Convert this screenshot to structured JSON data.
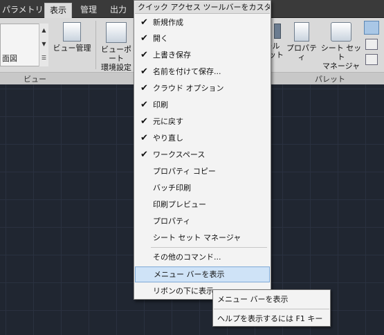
{
  "tabs": [
    {
      "label": "パラメトリック"
    },
    {
      "label": "表示"
    },
    {
      "label": "管理"
    },
    {
      "label": "出力"
    }
  ],
  "ribbon": {
    "view_list": {
      "rows": [
        "",
        "",
        "面図"
      ]
    },
    "view_manager_label": "ビュー管理",
    "viewport_label_line1": "ビューポート",
    "viewport_label_line2": "環境設定",
    "tool_label_1": "ツール",
    "tool_label_2": "パレット",
    "properties_label": "プロパティ",
    "sheetset_label_line1": "シート セット",
    "sheetset_label_line2": "マネージャ",
    "panel_views": "ビュー",
    "panel_palettes": "パレット"
  },
  "menu": {
    "header": "クイック アクセス ツールバーをカスタマイズ",
    "items": [
      {
        "label": "新規作成",
        "checked": true
      },
      {
        "label": "開く",
        "checked": true
      },
      {
        "label": "上書き保存",
        "checked": true
      },
      {
        "label": "名前を付けて保存...",
        "checked": true
      },
      {
        "label": "クラウド オプション",
        "checked": true
      },
      {
        "label": "印刷",
        "checked": true
      },
      {
        "label": "元に戻す",
        "checked": true
      },
      {
        "label": "やり直し",
        "checked": true
      },
      {
        "label": "ワークスペース",
        "checked": true
      },
      {
        "label": "プロパティ コピー",
        "checked": false
      },
      {
        "label": "バッチ印刷",
        "checked": false
      },
      {
        "label": "印刷プレビュー",
        "checked": false
      },
      {
        "label": "プロパティ",
        "checked": false
      },
      {
        "label": "シート セット マネージャ",
        "checked": false
      },
      {
        "label": "その他のコマンド...",
        "checked": false
      },
      {
        "label": "メニュー バーを表示",
        "checked": false
      },
      {
        "label": "リボンの下に表示",
        "checked": false
      }
    ],
    "check_glyph": "✔"
  },
  "tooltip": {
    "title": "メニュー バーを表示",
    "help": "ヘルプを表示するには F1 キー"
  }
}
